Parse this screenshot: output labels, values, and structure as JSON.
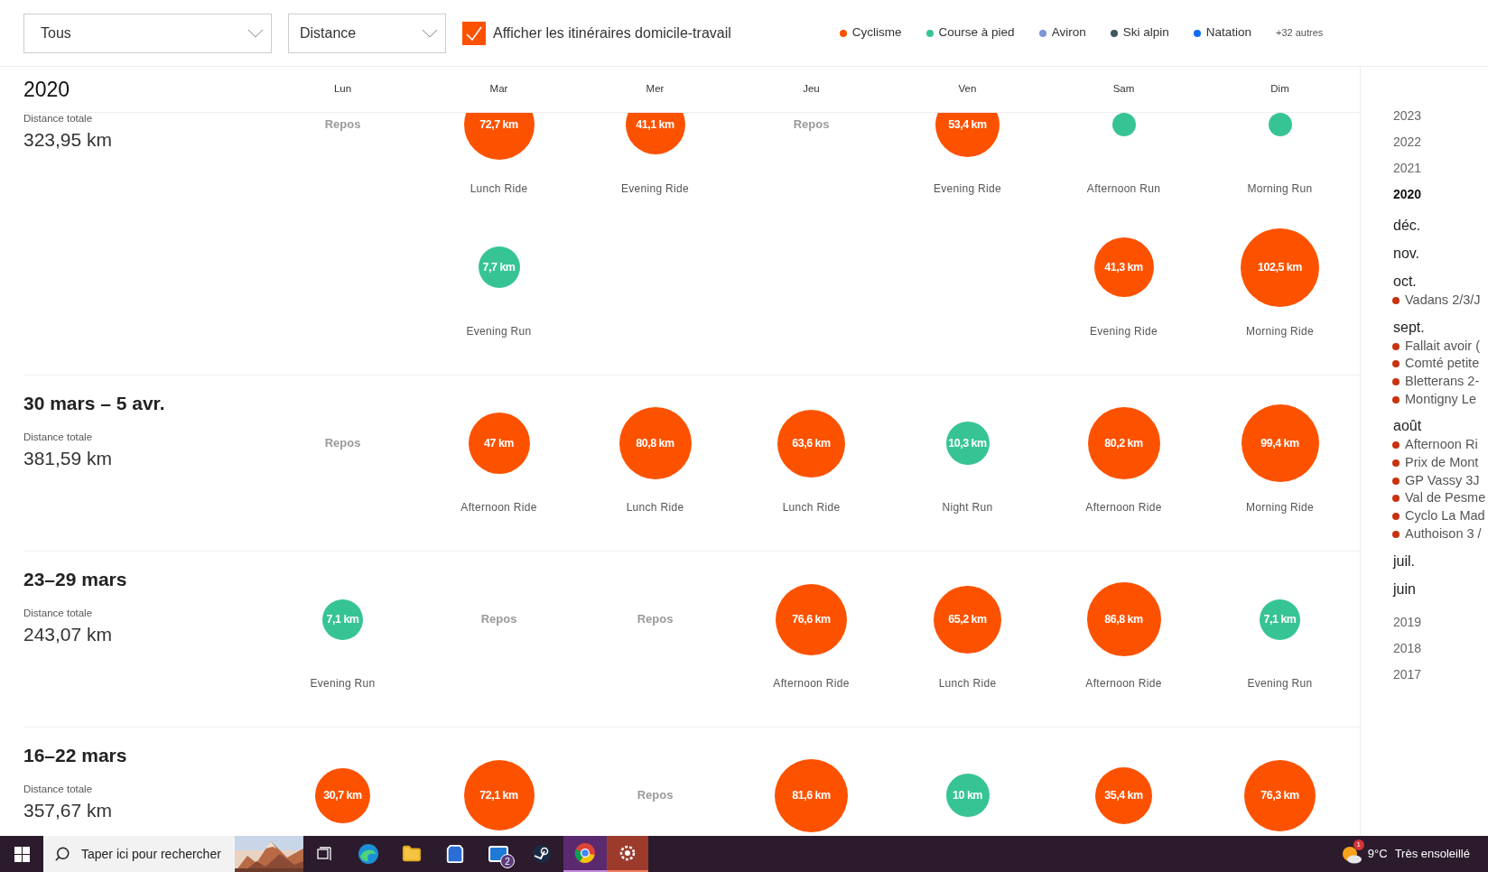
{
  "filters": {
    "sport": "Tous",
    "metric": "Distance",
    "commute": {
      "label": "Afficher les itinéraires domicile-travail",
      "checked": true
    }
  },
  "legend": [
    {
      "label": "Cyclisme",
      "color": "#fc5200"
    },
    {
      "label": "Course à pied",
      "color": "#37c495"
    },
    {
      "label": "Aviron",
      "color": "#7b95d6"
    },
    {
      "label": "Ski alpin",
      "color": "#3d5561"
    },
    {
      "label": "Natation",
      "color": "#0f6cf5"
    }
  ],
  "legend_more": "+32 autres",
  "header": {
    "year": "2020",
    "days": [
      "Lun",
      "Mar",
      "Mer",
      "Jeu",
      "Ven",
      "Sam",
      "Dim"
    ]
  },
  "weeks": [
    {
      "total_label": "Distance totale",
      "total": "323,95 km",
      "days": [
        [
          {
            "kind": "rest",
            "label": "Repos"
          }
        ],
        [
          {
            "kind": "ride",
            "distance": "72,7 km",
            "name": "Lunch Ride"
          },
          {
            "kind": "run",
            "distance": "7,7 km",
            "name": "Evening Run"
          }
        ],
        [
          {
            "kind": "ride",
            "distance": "41,1 km",
            "name": "Evening Ride"
          }
        ],
        [
          {
            "kind": "rest",
            "label": "Repos"
          }
        ],
        [
          {
            "kind": "ride",
            "distance": "53,4 km",
            "name": "Evening Ride"
          }
        ],
        [
          {
            "kind": "run",
            "name": "Afternoon Run"
          },
          {
            "kind": "ride",
            "distance": "41,3 km",
            "name": "Evening Ride"
          }
        ],
        [
          {
            "kind": "run",
            "name": "Morning Run"
          },
          {
            "kind": "ride",
            "distance": "102,5 km",
            "name": "Morning Ride"
          }
        ]
      ]
    },
    {
      "title": "30 mars – 5 avr.",
      "total_label": "Distance totale",
      "total": "381,59 km",
      "days": [
        [
          {
            "kind": "rest",
            "label": "Repos"
          }
        ],
        [
          {
            "kind": "ride",
            "distance": "47 km",
            "name": "Afternoon Ride"
          }
        ],
        [
          {
            "kind": "ride",
            "distance": "80,8 km",
            "name": "Lunch Ride"
          }
        ],
        [
          {
            "kind": "ride",
            "distance": "63,6 km",
            "name": "Lunch Ride"
          }
        ],
        [
          {
            "kind": "run",
            "distance": "10,3 km",
            "name": "Night Run"
          }
        ],
        [
          {
            "kind": "ride",
            "distance": "80,2 km",
            "name": "Afternoon Ride"
          }
        ],
        [
          {
            "kind": "ride",
            "distance": "99,4 km",
            "name": "Morning Ride"
          }
        ]
      ]
    },
    {
      "title": "23–29 mars",
      "total_label": "Distance totale",
      "total": "243,07 km",
      "days": [
        [
          {
            "kind": "run",
            "distance": "7,1 km",
            "name": "Evening Run"
          }
        ],
        [
          {
            "kind": "rest",
            "label": "Repos"
          }
        ],
        [
          {
            "kind": "rest",
            "label": "Repos"
          }
        ],
        [
          {
            "kind": "ride",
            "distance": "76,6 km",
            "name": "Afternoon Ride"
          }
        ],
        [
          {
            "kind": "ride",
            "distance": "65,2 km",
            "name": "Lunch Ride"
          }
        ],
        [
          {
            "kind": "ride",
            "distance": "86,8 km",
            "name": "Afternoon Ride"
          }
        ],
        [
          {
            "kind": "run",
            "distance": "7,1 km",
            "name": "Evening Run"
          }
        ]
      ]
    },
    {
      "title": "16–22 mars",
      "total_label": "Distance totale",
      "total": "357,67 km",
      "days": [
        [
          {
            "kind": "ride",
            "distance": "30,7 km"
          }
        ],
        [
          {
            "kind": "ride",
            "distance": "72,1 km"
          }
        ],
        [
          {
            "kind": "rest",
            "label": "Repos"
          }
        ],
        [
          {
            "kind": "ride",
            "distance": "81,6 km"
          }
        ],
        [
          {
            "kind": "run",
            "distance": "10 km"
          }
        ],
        [
          {
            "kind": "ride",
            "distance": "35,4 km"
          }
        ],
        [
          {
            "kind": "ride",
            "distance": "76,3 km"
          }
        ]
      ]
    }
  ],
  "sidebar": [
    {
      "label": "2023",
      "selected": false
    },
    {
      "label": "2022",
      "selected": false
    },
    {
      "label": "2021",
      "selected": false
    },
    {
      "label": "2020",
      "selected": true,
      "months": [
        {
          "label": "déc."
        },
        {
          "label": "nov."
        },
        {
          "label": "oct.",
          "events": [
            "Vadans 2/3/J"
          ]
        },
        {
          "label": "sept.",
          "events": [
            "Fallait avoir (",
            "Comté petite",
            "Bletterans 2-",
            "Montigny Le"
          ]
        },
        {
          "label": "août",
          "events": [
            "Afternoon Ri",
            "Prix de Mont",
            "GP Vassy 3J",
            "Val de Pesme",
            "Cyclo La Mad",
            "Authoison 3 /"
          ]
        },
        {
          "label": "juil."
        },
        {
          "label": "juin"
        }
      ]
    },
    {
      "label": "2019",
      "selected": false
    },
    {
      "label": "2018",
      "selected": false
    },
    {
      "label": "2017",
      "selected": false
    }
  ],
  "taskbar": {
    "search_placeholder": "Taper ici pour rechercher",
    "mail_badge": "2",
    "weather_badge": "1",
    "temperature": "9°C",
    "weather": "Très ensoleillé"
  }
}
